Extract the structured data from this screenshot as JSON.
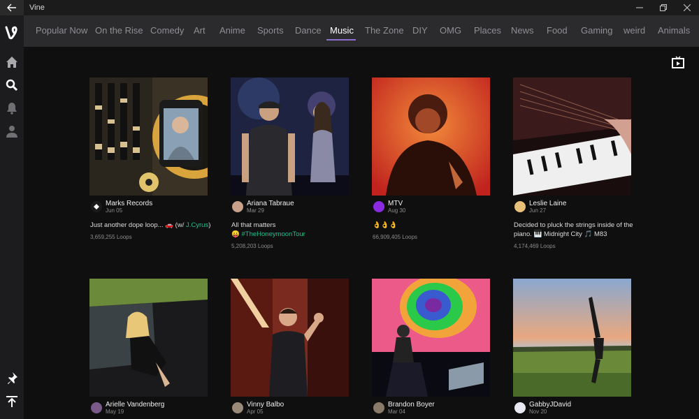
{
  "window": {
    "title": "Vine"
  },
  "tabs": [
    {
      "label": "Popular Now",
      "active": false
    },
    {
      "label": "On the Rise",
      "active": false
    },
    {
      "label": "Comedy",
      "active": false
    },
    {
      "label": "Art",
      "active": false
    },
    {
      "label": "Anime",
      "active": false
    },
    {
      "label": "Sports",
      "active": false
    },
    {
      "label": "Dance",
      "active": false
    },
    {
      "label": "Music",
      "active": true
    },
    {
      "label": "The Zone",
      "active": false
    },
    {
      "label": "DIY",
      "active": false
    },
    {
      "label": "OMG",
      "active": false
    },
    {
      "label": "Places",
      "active": false
    },
    {
      "label": "News",
      "active": false
    },
    {
      "label": "Food",
      "active": false
    },
    {
      "label": "Gaming",
      "active": false
    },
    {
      "label": "weird",
      "active": false
    },
    {
      "label": "Animals",
      "active": false
    }
  ],
  "posts": [
    {
      "author": "Marks Records",
      "date": "Jun 05",
      "caption_text": "Just another dope loop... 🚗 (w/ ",
      "caption_link": "J.Cyrus",
      "caption_end": ")",
      "loops": "3,659,255 Loops"
    },
    {
      "author": "Ariana Tabraue",
      "date": "Mar 29",
      "caption_text": "All that matters",
      "caption_line2_emoji": "😛",
      "caption_line2_link": "#TheHoneymoonTour",
      "loops": "5,208,203 Loops"
    },
    {
      "author": "MTV",
      "date": "Aug 30",
      "caption_text": "👌👌👌",
      "loops": "66,909,405 Loops"
    },
    {
      "author": "Leslie Laine",
      "date": "Jun 27",
      "caption_text": "Decided to pluck the strings inside of the piano. 🎹 Midnight City 🎵 M83",
      "loops": "4,174,469 Loops"
    },
    {
      "author": "Arielle Vandenberg",
      "date": "May 19"
    },
    {
      "author": "Vinny Balbo",
      "date": "Apr 05"
    },
    {
      "author": "Brandon Boyer",
      "date": "Mar 04"
    },
    {
      "author": "GabbyJDavid",
      "date": "Nov 20"
    }
  ],
  "colors": {
    "accent": "#8a6fcf",
    "link": "#1dc08f",
    "background": "#0f0f10",
    "nav": "#2b2b2d"
  }
}
